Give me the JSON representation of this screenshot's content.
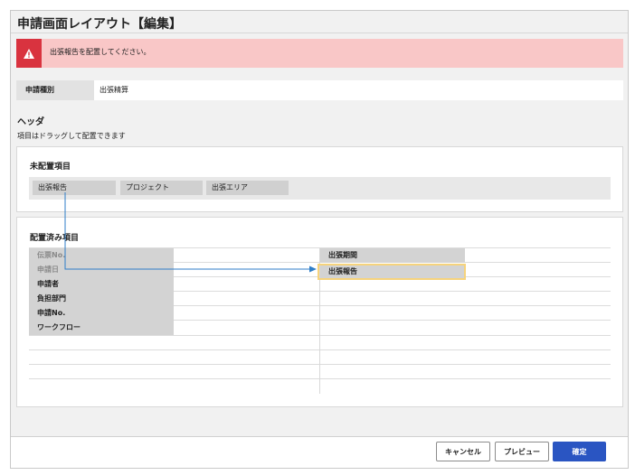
{
  "window": {
    "title": "申請画面レイアウト【編集】"
  },
  "alert": {
    "icon": "warning-icon",
    "message": "出張報告を配置してください。",
    "color": "#d9333f",
    "background": "#f9c7c7"
  },
  "request_type": {
    "label": "申請種別",
    "value": "出張精算"
  },
  "header_section": {
    "title": "ヘッダ",
    "description": "項目はドラッグして配置できます"
  },
  "unplaced": {
    "title": "未配置項目",
    "items": [
      {
        "label": "出張報告"
      },
      {
        "label": "プロジェクト"
      },
      {
        "label": "出張エリア"
      }
    ]
  },
  "placed": {
    "title": "配置済み項目",
    "left_column": [
      {
        "label": "伝票No.",
        "dimmed": true
      },
      {
        "label": "申請日",
        "dimmed": true
      },
      {
        "label": "申請者",
        "dimmed": false
      },
      {
        "label": "負担部門",
        "dimmed": false
      },
      {
        "label": "申請No.",
        "dimmed": false
      },
      {
        "label": "ワークフロー",
        "dimmed": false
      }
    ],
    "right_column": [
      {
        "label": "出張期間"
      },
      {
        "label": "出張報告",
        "highlighted": true
      }
    ]
  },
  "footer": {
    "cancel_label": "キャンセル",
    "preview_label": "プレビュー",
    "confirm_label": "確定",
    "confirm_color": "#2a55c2"
  }
}
